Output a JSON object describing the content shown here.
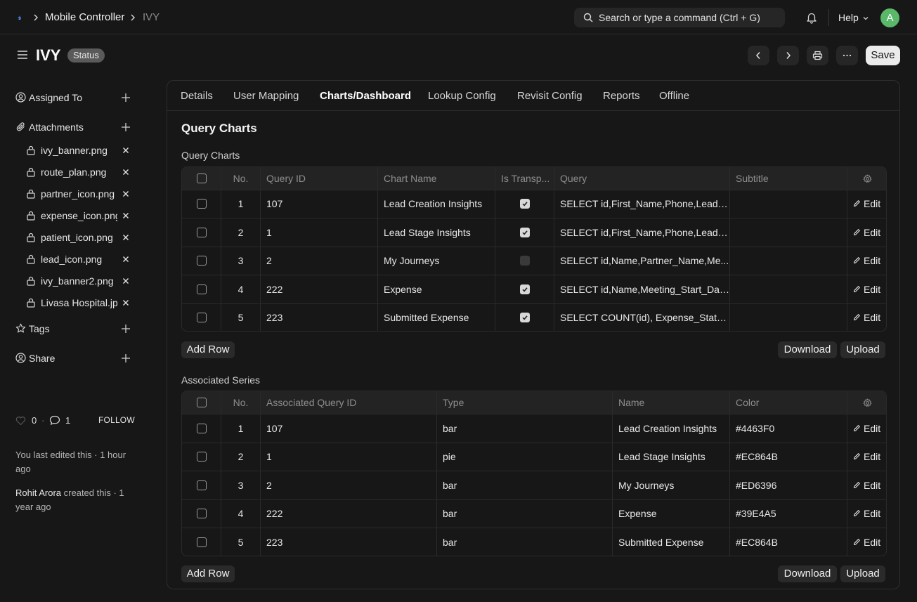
{
  "navbar": {
    "breadcrumbs": [
      "Mobile Controller",
      "IVY"
    ],
    "search_text": "Search or type a command (Ctrl + G)",
    "help_label": "Help",
    "avatar_initial": "A"
  },
  "page": {
    "title": "IVY",
    "status": "Status",
    "save_label": "Save"
  },
  "sidebar": {
    "assigned_to": "Assigned To",
    "attachments_label": "Attachments",
    "attachments": [
      "ivy_banner.png",
      "route_plan.png",
      "partner_icon.png",
      "expense_icon.png",
      "patient_icon.png",
      "lead_icon.png",
      "ivy_banner2.png",
      "Livasa Hospital.jpg"
    ],
    "tags": "Tags",
    "share": "Share",
    "like_count": "0",
    "comment_count": "1",
    "follow": "FOLLOW",
    "last_edited": "You last edited this · 1 hour ago",
    "creator": "Rohit Arora",
    "created_text": " created this · 1 year ago"
  },
  "tabs": [
    "Details",
    "User Mapping",
    "Charts/Dashboard",
    "Lookup Config",
    "Revisit Config",
    "Reports",
    "Offline"
  ],
  "active_tab": "Charts/Dashboard",
  "section_title": "Query Charts",
  "query_charts": {
    "label": "Query Charts",
    "columns": [
      "No.",
      "Query ID",
      "Chart Name",
      "Is Transp...",
      "Query",
      "Subtitle"
    ],
    "rows": [
      {
        "no": "1",
        "query_id": "107",
        "chart_name": "Lead Creation Insights",
        "is_transparent": true,
        "query": "SELECT id,First_Name,Phone,Lead_...",
        "subtitle": ""
      },
      {
        "no": "2",
        "query_id": "1",
        "chart_name": "Lead Stage Insights",
        "is_transparent": true,
        "query": "SELECT id,First_Name,Phone,Lead_...",
        "subtitle": ""
      },
      {
        "no": "3",
        "query_id": "2",
        "chart_name": "My Journeys",
        "is_transparent": false,
        "query": "SELECT id,Name,Partner_Name,Me...",
        "subtitle": ""
      },
      {
        "no": "4",
        "query_id": "222",
        "chart_name": "Expense",
        "is_transparent": true,
        "query": "SELECT id,Name,Meeting_Start_Dat...",
        "subtitle": ""
      },
      {
        "no": "5",
        "query_id": "223",
        "chart_name": "Submitted Expense",
        "is_transparent": true,
        "query": "SELECT COUNT(id), Expense_Statu...",
        "subtitle": ""
      }
    ]
  },
  "associated_series": {
    "label": "Associated Series",
    "columns": [
      "No.",
      "Associated Query ID",
      "Type",
      "Name",
      "Color"
    ],
    "rows": [
      {
        "no": "1",
        "query_id": "107",
        "type": "bar",
        "name": "Lead Creation Insights",
        "color": "#4463F0"
      },
      {
        "no": "2",
        "query_id": "1",
        "type": "pie",
        "name": "Lead Stage Insights",
        "color": "#EC864B"
      },
      {
        "no": "3",
        "query_id": "2",
        "type": "bar",
        "name": "My Journeys",
        "color": "#ED6396"
      },
      {
        "no": "4",
        "query_id": "222",
        "type": "bar",
        "name": "Expense",
        "color": "#39E4A5"
      },
      {
        "no": "5",
        "query_id": "223",
        "type": "bar",
        "name": "Submitted Expense",
        "color": "#EC864B"
      }
    ]
  },
  "buttons": {
    "add_row": "Add Row",
    "download": "Download",
    "upload": "Upload",
    "edit": "Edit"
  },
  "icons": {
    "logo": "app-logo-icon",
    "search": "search-icon",
    "bell": "bell-icon",
    "menu": "hamburger-icon",
    "settings": "gear-icon",
    "attachment": "lock-icon"
  }
}
